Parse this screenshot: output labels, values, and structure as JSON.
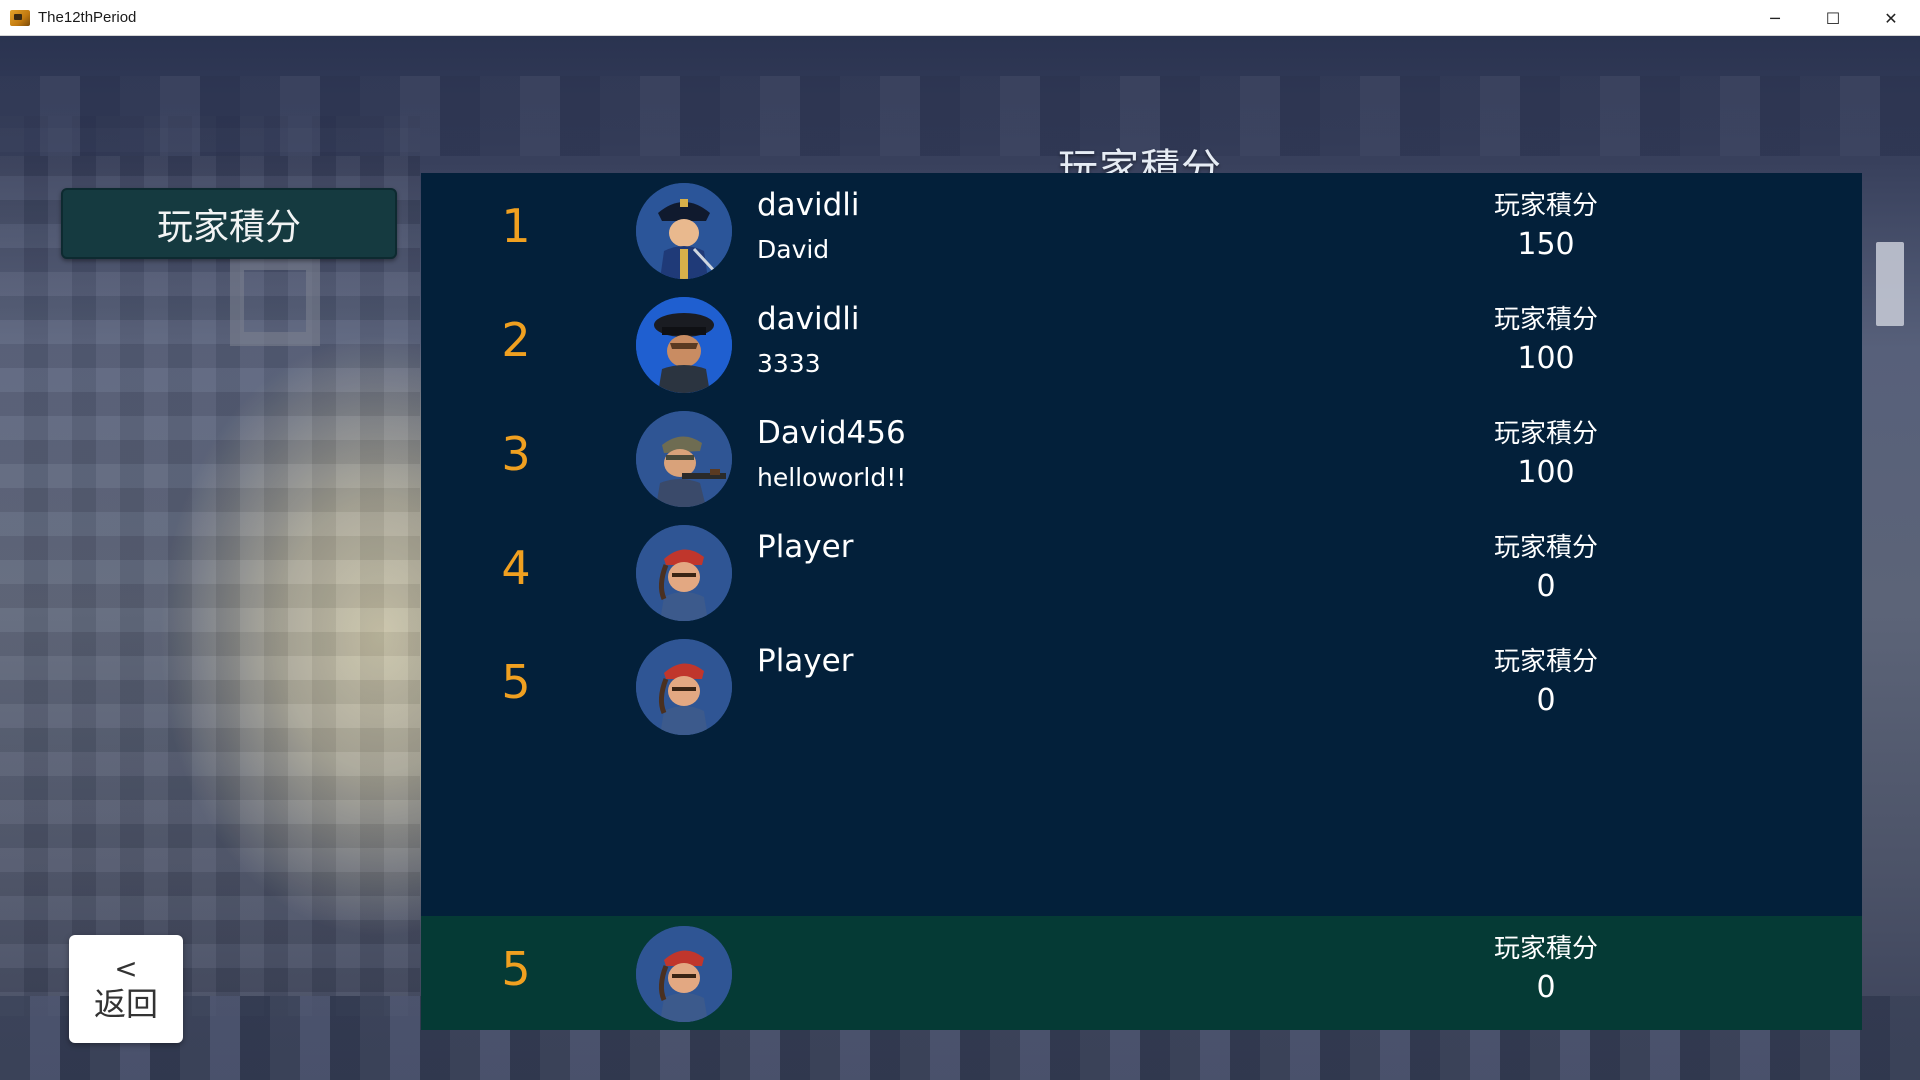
{
  "window": {
    "title": "The12thPeriod",
    "minimize_icon": "─",
    "maximize_icon": "☐",
    "close_icon": "✕"
  },
  "screen": {
    "title": "玩家積分"
  },
  "sidebar": {
    "tab_label": "玩家積分"
  },
  "back_button": {
    "arrow": "<",
    "label": "返回"
  },
  "leaderboard": {
    "score_label": "玩家積分",
    "rows": [
      {
        "rank": "1",
        "name": "davidli",
        "message": "David",
        "score": "150",
        "avatar": "captain-avatar-icon"
      },
      {
        "rank": "2",
        "name": "davidli",
        "message": "3333",
        "score": "100",
        "avatar": "officer-cap-avatar-icon"
      },
      {
        "rank": "3",
        "name": "David456",
        "message": "helloworld!!",
        "score": "100",
        "avatar": "soldier-rifle-avatar-icon"
      },
      {
        "rank": "4",
        "name": "Player",
        "message": "",
        "score": "0",
        "avatar": "bandana-avatar-icon"
      },
      {
        "rank": "5",
        "name": "Player",
        "message": "",
        "score": "0",
        "avatar": "bandana-avatar-icon"
      }
    ],
    "my_row": {
      "rank": "5",
      "score_label": "玩家積分",
      "score": "0",
      "avatar": "bandana-avatar-icon"
    }
  },
  "colors": {
    "board_bg": "#03203a",
    "my_row_bg": "#053a35",
    "rank_color": "#f0a020",
    "tab_bg": "#153a40"
  }
}
